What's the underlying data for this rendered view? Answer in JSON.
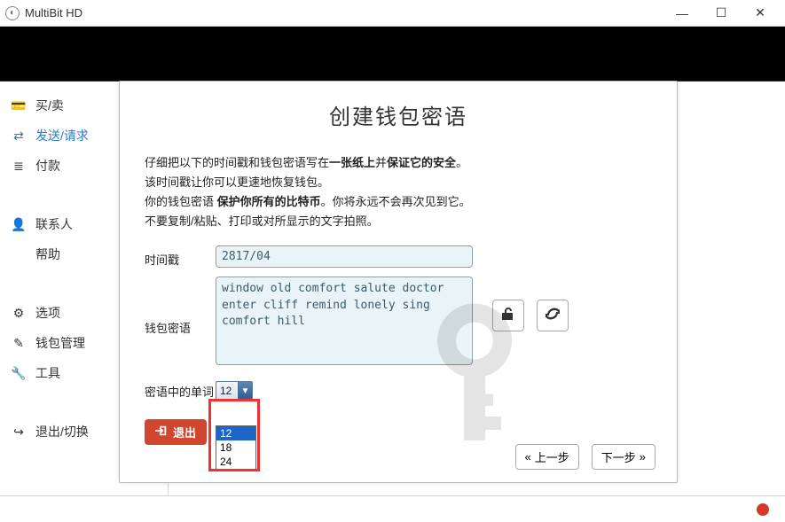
{
  "window": {
    "title": "MultiBit HD"
  },
  "sidebar": {
    "items": [
      {
        "label": "买/卖",
        "icon": "💳"
      },
      {
        "label": "发送/请求",
        "icon": "⇄"
      },
      {
        "label": "付款",
        "icon": "≣"
      },
      {
        "label": "联系人",
        "icon": "👤"
      },
      {
        "label": "帮助",
        "icon": "❓"
      },
      {
        "label": "选项",
        "icon": "⚙"
      },
      {
        "label": "钱包管理",
        "icon": "✎"
      },
      {
        "label": "工具",
        "icon": "🔧"
      },
      {
        "label": "退出/切换",
        "icon": "↪"
      }
    ]
  },
  "dialog": {
    "title": "创建钱包密语",
    "line1_a": "仔细把以下的时间戳和钱包密语写在",
    "line1_b": "一张纸上",
    "line1_c": "并",
    "line1_d": "保证它的安全",
    "line1_e": "。",
    "line2": "该时间戳让你可以更速地恢复钱包。",
    "line3_a": "你的钱包密语 ",
    "line3_b": "保护你所有的比特币",
    "line3_c": "。你将永远不会再次见到它。",
    "line4": "不要复制/粘贴、打印或对所显示的文字拍照。",
    "timestamp_label": "时间戳",
    "timestamp_value": "2817/04",
    "seed_label": "钱包密语",
    "seed_value": "window old comfort salute doctor\nenter cliff remind lonely sing\ncomfort hill",
    "wordcount_label": "密语中的单词",
    "wordcount_value": "12",
    "wordcount_options": [
      "12",
      "18",
      "24"
    ],
    "exit_label": "退出",
    "prev_label": "上一步",
    "next_label": "下一步"
  }
}
